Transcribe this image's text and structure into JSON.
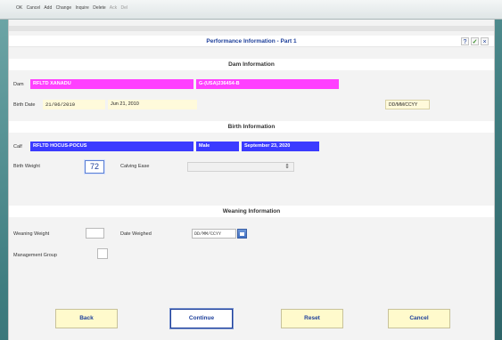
{
  "toolbar": {
    "items": [
      "OK",
      "Cancel",
      "Add",
      "Change",
      "Inquire",
      "Delete",
      "Ack",
      "Del"
    ]
  },
  "page": {
    "title": "Performance Information - Part 1",
    "icons": [
      "help-icon",
      "check-icon",
      "close-icon"
    ]
  },
  "dam": {
    "heading": "Dam Information",
    "dam_label": "Dam",
    "dam_name": "RFLTD XANADU",
    "dam_id": "G-(USA)236454-B",
    "birth_date_label": "Birth Date",
    "birth_date_value": "21/06/2010",
    "birth_date_long": "Jun 21, 2010",
    "date_format_hint": "DD/MM/CCYY"
  },
  "birth": {
    "heading": "Birth Information",
    "calf_label": "Calf",
    "calf_name": "RFLTD HOCUS-POCUS",
    "sex": "Male",
    "birth_date": "September 23, 2020",
    "birth_weight_label": "Birth Weight",
    "birth_weight_value": "72",
    "calving_ease_label": "Calving Ease",
    "calving_ease_value": ""
  },
  "weaning": {
    "heading": "Weaning Information",
    "weaning_weight_label": "Weaning Weight",
    "weaning_weight_value": "",
    "date_weighed_label": "Date Weighed",
    "date_weighed_placeholder": "DD/MM/CCYY",
    "management_group_label": "Management Group",
    "management_group_value": ""
  },
  "buttons": {
    "back": "Back",
    "continue": "Continue",
    "reset": "Reset",
    "cancel": "Cancel"
  }
}
